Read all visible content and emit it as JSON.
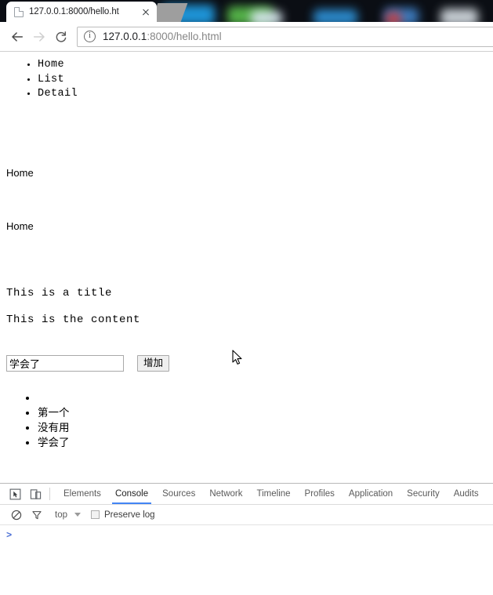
{
  "browser": {
    "tab": {
      "title": "127.0.0.1:8000/hello.ht",
      "favicon_name": "page-icon",
      "close_name": "close-icon"
    },
    "toolbar": {
      "back_label": "back-arrow-icon",
      "forward_label": "forward-arrow-icon",
      "reload_label": "reload-icon",
      "url_host": "127.0.0.1",
      "url_rest": ":8000/hello.html",
      "url_full": "127.0.0.1:8000/hello.html",
      "security_icon": "info-circle-icon"
    }
  },
  "page": {
    "nav_list": [
      "Home",
      "List",
      "Detail"
    ],
    "text_home_1": "Home",
    "text_home_2": "Home",
    "title_text": "This is a title",
    "content_text": "This is the content",
    "form": {
      "input_value": "学会了",
      "input_placeholder": "",
      "add_button_label": "增加"
    },
    "todo_list": [
      "",
      "第一个",
      "没有用",
      "学会了"
    ]
  },
  "devtools": {
    "tools": {
      "inspect_icon": "inspect-element-icon",
      "device_icon": "device-toolbar-icon"
    },
    "tabs": [
      {
        "label": "Elements",
        "active": false
      },
      {
        "label": "Console",
        "active": true
      },
      {
        "label": "Sources",
        "active": false
      },
      {
        "label": "Network",
        "active": false
      },
      {
        "label": "Timeline",
        "active": false
      },
      {
        "label": "Profiles",
        "active": false
      },
      {
        "label": "Application",
        "active": false
      },
      {
        "label": "Security",
        "active": false
      },
      {
        "label": "Audits",
        "active": false
      }
    ],
    "console": {
      "clear_icon": "clear-console-icon",
      "filter_icon": "filter-funnel-icon",
      "context": "top",
      "preserve_log_label": "Preserve log",
      "preserve_log_checked": false,
      "prompt": ">"
    }
  },
  "colors": {
    "accent_blue": "#4285f4",
    "prompt_blue": "#4a6fd4",
    "tabstrip_dark": "#0b0e14",
    "url_host": "#202124",
    "url_rest": "#868686"
  }
}
